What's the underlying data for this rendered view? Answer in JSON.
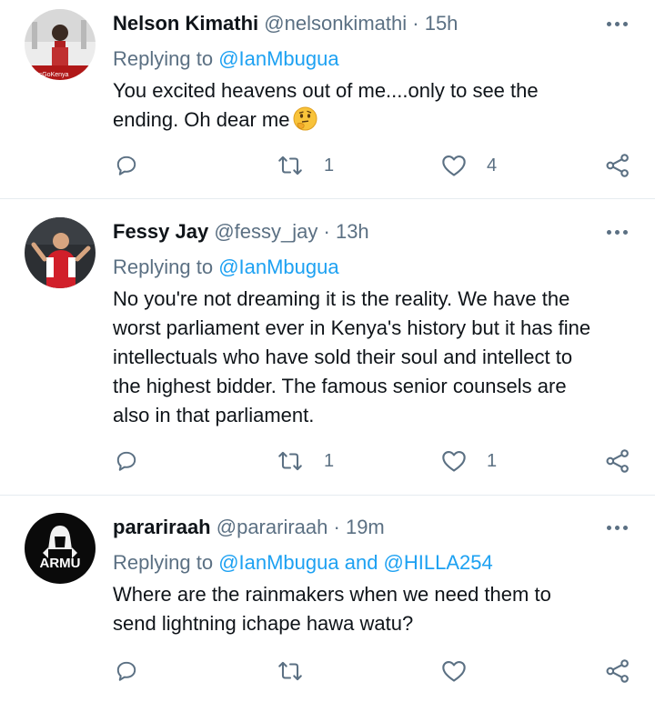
{
  "tweets": [
    {
      "name": "Nelson Kimathi",
      "handle": "@nelsonkimathi",
      "separator": "·",
      "time": "15h",
      "replying_prefix": "Replying to ",
      "mentions": "@IanMbugua",
      "text_lines": [
        "You excited heavens out of me....only to see the",
        "ending. Oh dear me"
      ],
      "emoji": "thinking-face",
      "avatar_caption": "LetsGoKenya",
      "reply_count": "",
      "retweet_count": "1",
      "like_count": "4"
    },
    {
      "name": "Fessy Jay",
      "handle": "@fessy_jay",
      "separator": "·",
      "time": "13h",
      "replying_prefix": "Replying to ",
      "mentions": "@IanMbugua",
      "text_lines": [
        "No you're not dreaming it is the reality. We have the",
        "worst parliament ever in Kenya's history but it has fine",
        "intellectuals who have sold their soul and intellect to",
        "the highest bidder. The famous senior counsels are",
        "also in that parliament."
      ],
      "reply_count": "",
      "retweet_count": "1",
      "like_count": "1"
    },
    {
      "name": "parariraah",
      "handle": "@parariraah",
      "separator": "·",
      "time": "19m",
      "replying_prefix": "Replying to ",
      "mentions": "@IanMbugua and @HILLA254",
      "text_lines": [
        "Where are the rainmakers when we need them to",
        "send lightning ichape hawa watu?"
      ],
      "avatar_caption": "ARMU",
      "reply_count": "",
      "retweet_count": "",
      "like_count": ""
    }
  ],
  "icons": [
    "more-icon",
    "reply-icon",
    "retweet-icon",
    "like-icon",
    "share-icon"
  ],
  "colors": {
    "text": "#0f1419",
    "muted": "#5b7083",
    "link": "#1da1f2",
    "divider": "#e6ecf0"
  }
}
